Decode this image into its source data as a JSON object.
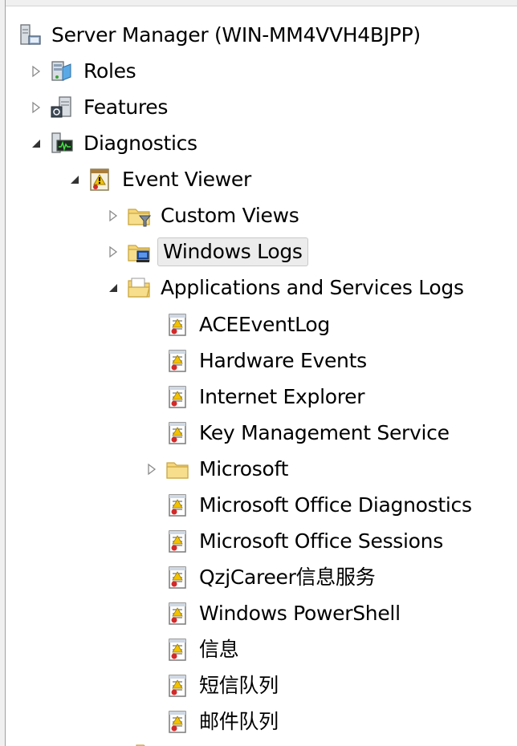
{
  "tree": {
    "root": {
      "label": "Server Manager (WIN-MM4VVH4BJPP)",
      "icon": "server-icon"
    },
    "roles": {
      "label": "Roles",
      "icon": "roles-icon",
      "expander": "collapsed"
    },
    "features": {
      "label": "Features",
      "icon": "features-icon",
      "expander": "collapsed"
    },
    "diagnostics": {
      "label": "Diagnostics",
      "icon": "diagnostics-icon",
      "expander": "expanded"
    },
    "event_viewer": {
      "label": "Event Viewer",
      "icon": "event-viewer-icon",
      "expander": "expanded"
    },
    "custom_views": {
      "label": "Custom Views",
      "icon": "folder-filter-icon",
      "expander": "collapsed"
    },
    "windows_logs": {
      "label": "Windows Logs",
      "icon": "folder-computer-icon",
      "expander": "collapsed",
      "selected": true
    },
    "app_services_logs": {
      "label": "Applications and Services Logs",
      "icon": "folder-open-icon",
      "expander": "expanded"
    },
    "logs": [
      {
        "label": "ACEEventLog",
        "icon": "log-icon"
      },
      {
        "label": "Hardware Events",
        "icon": "log-icon"
      },
      {
        "label": "Internet Explorer",
        "icon": "log-icon"
      },
      {
        "label": "Key Management Service",
        "icon": "log-icon"
      },
      {
        "label": "Microsoft",
        "icon": "folder-icon",
        "expander": "collapsed"
      },
      {
        "label": "Microsoft Office Diagnostics",
        "icon": "log-icon"
      },
      {
        "label": "Microsoft Office Sessions",
        "icon": "log-icon"
      },
      {
        "label": "QzjCareer信息服务",
        "icon": "log-icon"
      },
      {
        "label": "Windows PowerShell",
        "icon": "log-icon"
      },
      {
        "label": "信息",
        "icon": "log-icon"
      },
      {
        "label": "短信队列",
        "icon": "log-icon"
      },
      {
        "label": "邮件队列",
        "icon": "log-icon"
      }
    ]
  },
  "colors": {
    "selection_bg": "#ececec",
    "selection_border": "#c9c9c9",
    "folder_yellow": "#f5d67a",
    "log_red": "#d22a2a"
  }
}
